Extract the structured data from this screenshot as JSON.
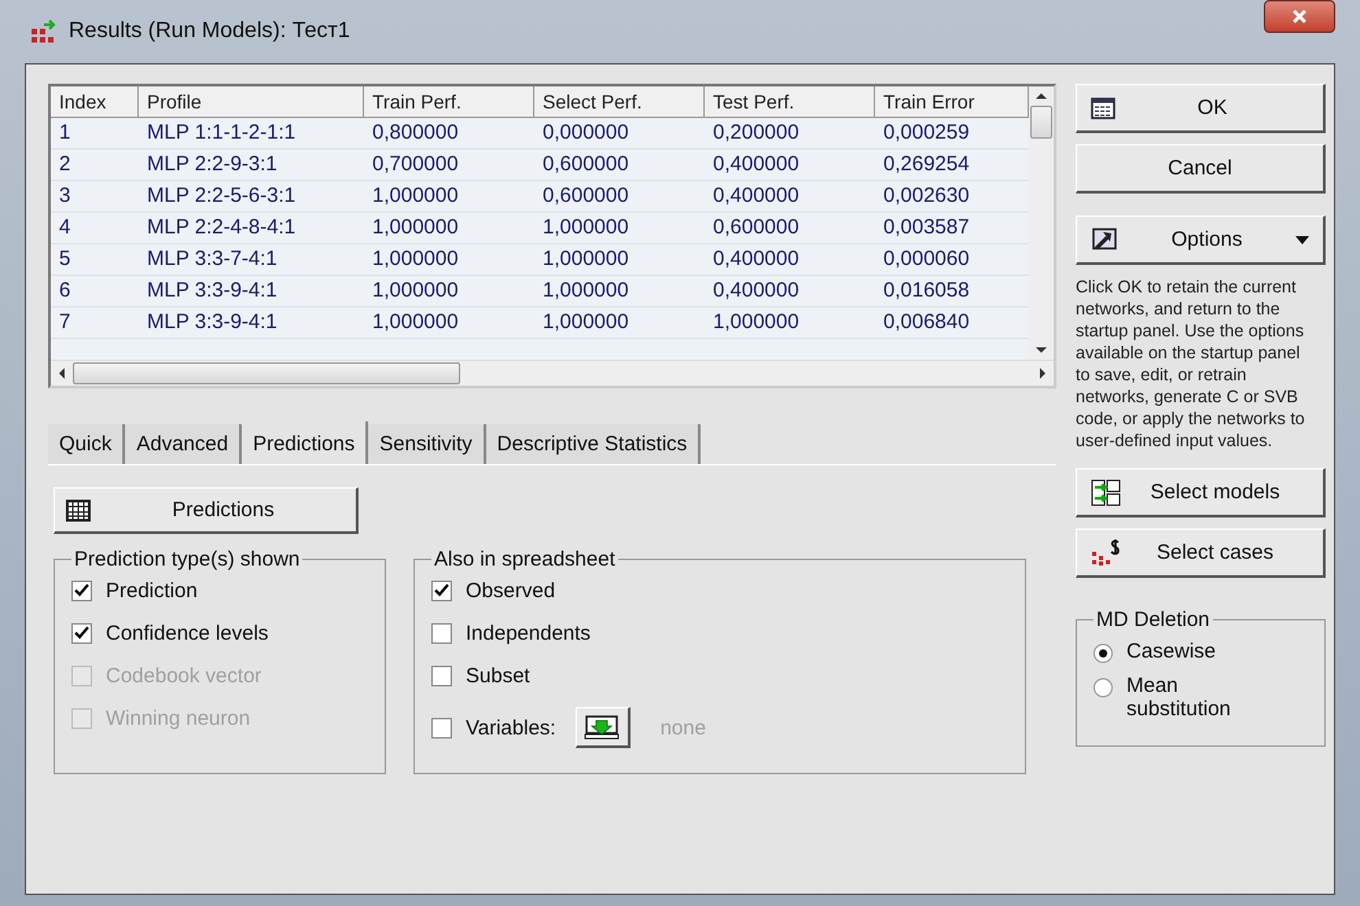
{
  "window": {
    "title": "Results (Run Models): Тест1"
  },
  "table": {
    "columns": [
      "Index",
      "Profile",
      "Train Perf.",
      "Select Perf.",
      "Test Perf.",
      "Train Error"
    ],
    "rows": [
      [
        "1",
        "MLP 1:1-1-2-1:1",
        "0,800000",
        "0,000000",
        "0,200000",
        "0,000259"
      ],
      [
        "2",
        "MLP 2:2-9-3:1",
        "0,700000",
        "0,600000",
        "0,400000",
        "0,269254"
      ],
      [
        "3",
        "MLP 2:2-5-6-3:1",
        "1,000000",
        "0,600000",
        "0,400000",
        "0,002630"
      ],
      [
        "4",
        "MLP 2:2-4-8-4:1",
        "1,000000",
        "1,000000",
        "0,600000",
        "0,003587"
      ],
      [
        "5",
        "MLP 3:3-7-4:1",
        "1,000000",
        "1,000000",
        "0,400000",
        "0,000060"
      ],
      [
        "6",
        "MLP 3:3-9-4:1",
        "1,000000",
        "1,000000",
        "0,400000",
        "0,016058"
      ],
      [
        "7",
        "MLP 3:3-9-4:1",
        "1,000000",
        "1,000000",
        "1,000000",
        "0,006840"
      ]
    ]
  },
  "tabs": [
    {
      "label": "Quick",
      "selected": false
    },
    {
      "label": "Advanced",
      "selected": false
    },
    {
      "label": "Predictions",
      "selected": true
    },
    {
      "label": "Sensitivity",
      "selected": false
    },
    {
      "label": "Descriptive Statistics",
      "selected": false
    }
  ],
  "predictions_button": "Predictions",
  "prediction_types": {
    "title": "Prediction type(s) shown",
    "items": [
      {
        "label": "Prediction",
        "checked": true,
        "disabled": false
      },
      {
        "label": "Confidence levels",
        "checked": true,
        "disabled": false
      },
      {
        "label": "Codebook vector",
        "checked": false,
        "disabled": true
      },
      {
        "label": "Winning neuron",
        "checked": false,
        "disabled": true
      }
    ]
  },
  "also_in_spreadsheet": {
    "title": "Also in spreadsheet",
    "items": [
      {
        "label": "Observed",
        "checked": true
      },
      {
        "label": "Independents",
        "checked": false
      },
      {
        "label": "Subset",
        "checked": false
      },
      {
        "label": "Variables:",
        "checked": false
      }
    ],
    "variables_value": "none"
  },
  "side": {
    "ok": "OK",
    "cancel": "Cancel",
    "options": "Options",
    "help": "Click OK to retain the current networks, and return to the startup panel. Use the options available on the startup panel to save, edit, or retrain networks, generate C or SVB code, or apply the networks to user-defined input values.",
    "select_models": "Select models",
    "select_cases": "Select cases"
  },
  "md_deletion": {
    "title": "MD Deletion",
    "options": [
      {
        "label": "Casewise",
        "selected": true
      },
      {
        "label": "Mean substitution",
        "selected": false
      }
    ]
  }
}
